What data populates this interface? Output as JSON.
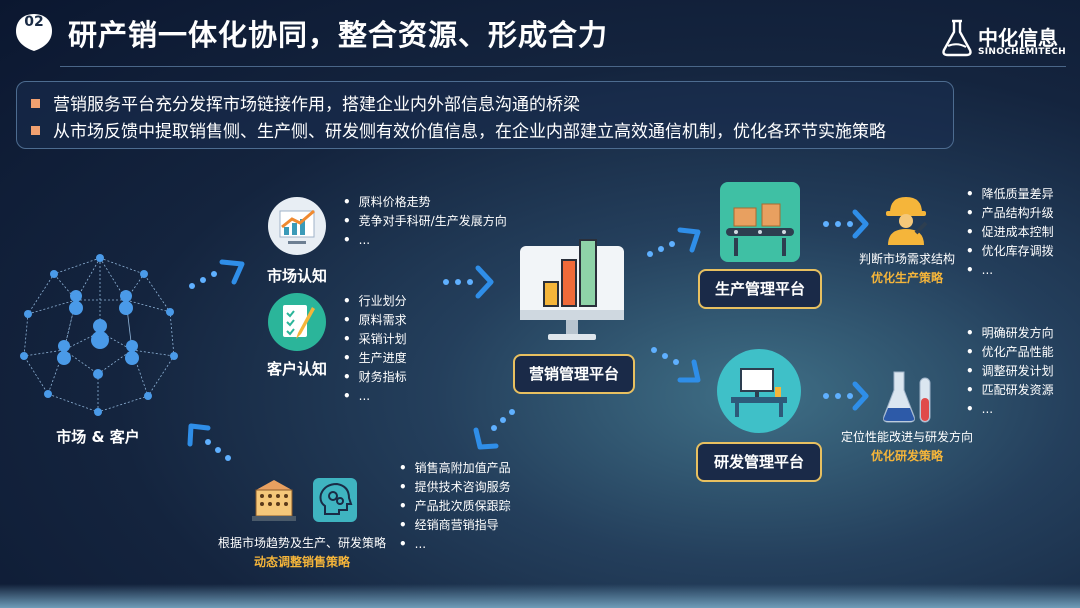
{
  "header": {
    "badge": "02",
    "title": "研产销一体化协同，整合资源、形成合力",
    "logo_cn": "中化信息",
    "logo_en": "SINOCHEMITECH"
  },
  "bullets": [
    "营销服务平台充分发挥市场链接作用，搭建企业内外部信息沟通的桥梁",
    "从市场反馈中提取销售侧、生产侧、研发侧有效价值信息，在企业内部建立高效通信机制，优化各环节实施策略"
  ],
  "market": {
    "label": "市场 & 客户"
  },
  "market_cognition": {
    "label": "市场认知",
    "items": [
      "原料价格走势",
      "竞争对手科研/生产发展方向",
      "..."
    ]
  },
  "customer_cognition": {
    "label": "客户认知",
    "items": [
      "行业划分",
      "原料需求",
      "采销计划",
      "生产进度",
      "财务指标",
      "..."
    ]
  },
  "center": {
    "label": "营销管理平台"
  },
  "production": {
    "label": "生产管理平台",
    "items": [
      "降低质量差异",
      "产品结构升级",
      "促进成本控制",
      "优化库存调拨",
      "..."
    ],
    "note": "判断市场需求结构",
    "strategy": "优化生产策略"
  },
  "rnd": {
    "label": "研发管理平台",
    "items": [
      "明确研发方向",
      "优化产品性能",
      "调整研发计划",
      "匹配研发资源",
      "..."
    ],
    "note": "定位性能改进与研发方向",
    "strategy": "优化研发策略"
  },
  "sales": {
    "items": [
      "销售高附加值产品",
      "提供技术咨询服务",
      "产品批次质保跟踪",
      "经销商营销指导",
      "..."
    ],
    "note": "根据市场趋势及生产、研发策略",
    "strategy": "动态调整销售策略"
  },
  "colors": {
    "accent_gold": "#f5b53a",
    "platform_border": "#e8c060",
    "arrow_blue": "#2f8ee8",
    "bullet_square": "#f0a070"
  }
}
